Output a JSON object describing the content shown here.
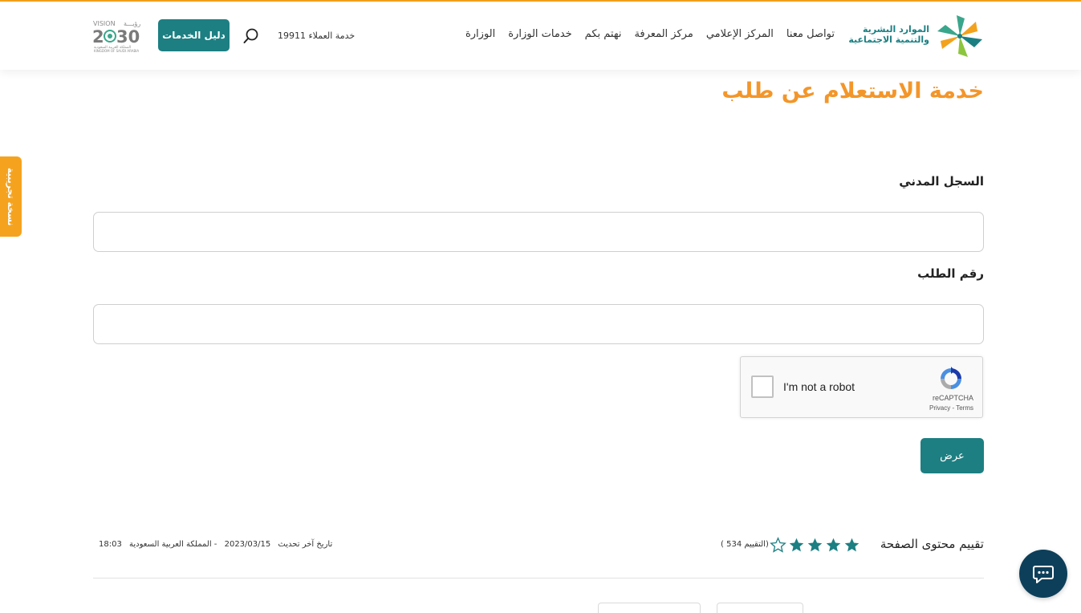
{
  "header": {
    "logo_line1": "الموارد البشرية",
    "logo_line2": "والتنمية الاجتماعية",
    "nav": [
      "الوزارة",
      "خدمات الوزارة",
      "نهتم بكم",
      "مركز المعرفة",
      "المركز الإعلامي",
      "تواصل معنا"
    ],
    "hotline": "خدمة العملاء 19911",
    "search_icon": "search-icon",
    "guide_label": "دليل الخدمات",
    "vision_top": "VISION رؤيـــة",
    "vision_year": "2030",
    "vision_bottom": "المملكة العربية السعودية KINGDOM OF SAUDI ARABIA"
  },
  "side_tab": "نسخة تجريبية",
  "page_title": "خدمة الاستعلام عن طلب",
  "form": {
    "civil_record_label": "السجل المدني",
    "civil_record_value": "",
    "request_number_label": "رقم الطلب",
    "request_number_value": "",
    "captcha_label": "I'm not a robot",
    "captcha_brand": "reCAPTCHA",
    "captcha_links": "Privacy - Terms",
    "submit_label": "عرض"
  },
  "rating": {
    "label": "تقييم محتوى الصفحة",
    "stars_filled": 4,
    "stars_total": 5,
    "count_text": "(التقييم 534 )"
  },
  "updated": {
    "label": "تاريخ آخر تحديث",
    "date": "2023/03/15",
    "location": "- المملكة العربية السعودية",
    "time": "18:03"
  },
  "colors": {
    "accent_orange": "#f3962a",
    "teal": "#1d7f82",
    "chat_navy": "#0e3f5a"
  },
  "chat_icon": "chat-bubble-icon"
}
